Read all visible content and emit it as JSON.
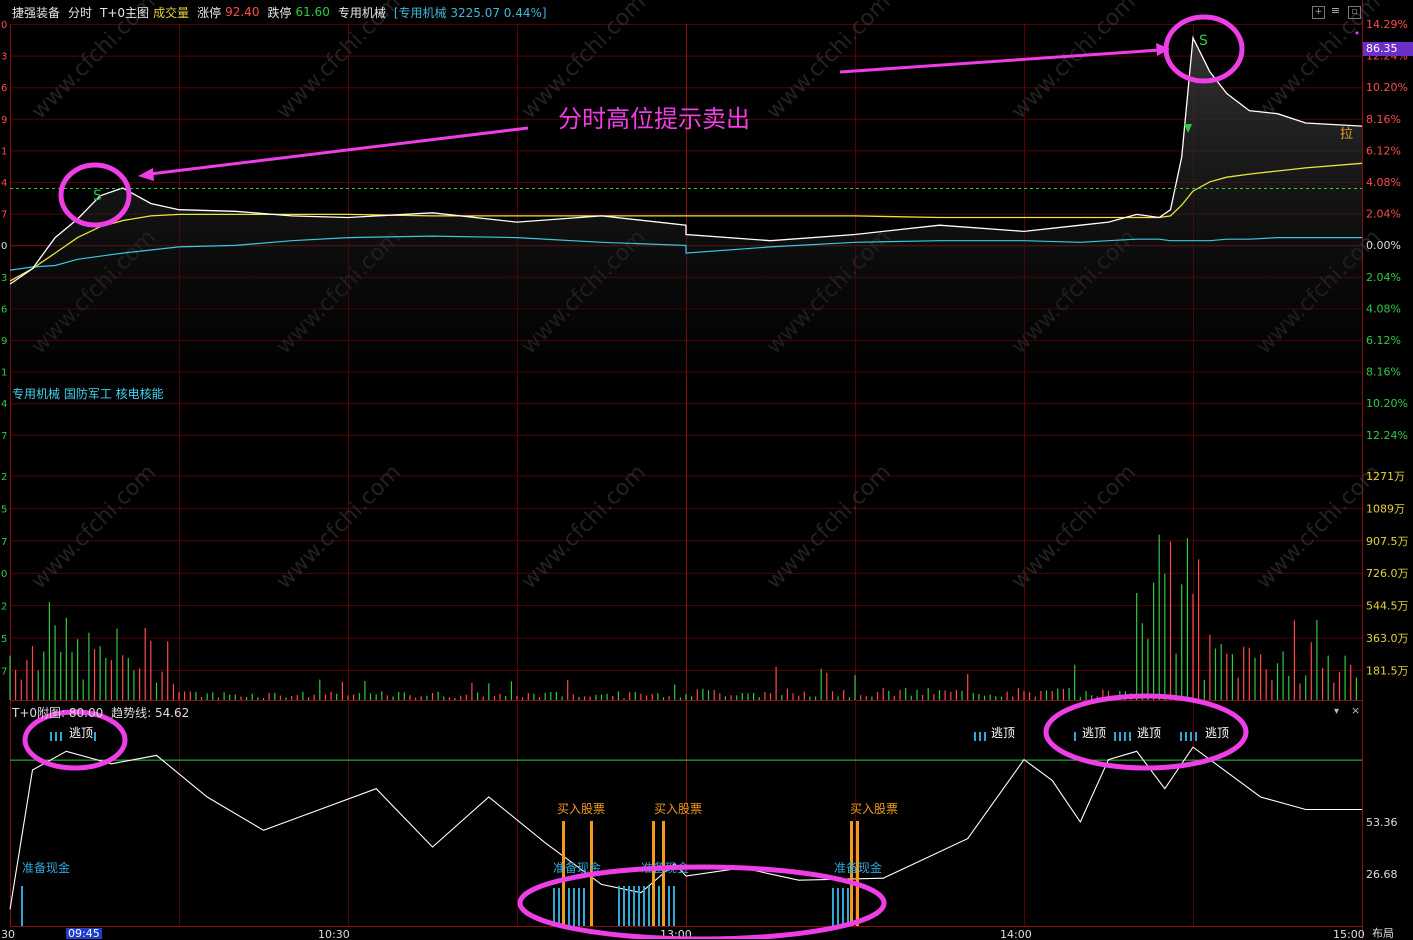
{
  "header": {
    "stock_name": "捷强装备",
    "tab_intraday": "分时",
    "tab_t0": "T+0主图",
    "volume_label": "成交量",
    "limit_up_label": "涨停",
    "limit_up_value": "92.40",
    "limit_down_label": "跌停",
    "limit_down_value": "61.60",
    "sector_name": "专用机械",
    "sector_index": "[专用机械 3225.07 0.44%]"
  },
  "sector_tags": "专用机械 国防军工 核电核能",
  "current_price_tag": "86.35",
  "right_axis_pct": [
    "14.29%",
    "12.24%",
    "10.20%",
    "8.16%",
    "6.12%",
    "4.08%",
    "2.04%",
    "0.00%",
    "2.04%",
    "4.08%",
    "6.12%",
    "8.16%",
    "10.20%",
    "12.24%"
  ],
  "left_axis_digits": [
    "0",
    "3",
    "6",
    "9",
    "1",
    "4",
    "7",
    "0",
    "3",
    "6",
    "9",
    "1",
    "4",
    "7",
    "2",
    "5",
    "7",
    "0",
    "2",
    "5",
    "7"
  ],
  "volume_axis": [
    "1271万",
    "1089万",
    "907.5万",
    "726.0万",
    "544.5万",
    "363.0万",
    "181.5万"
  ],
  "sub_axis": [
    "53.36",
    "26.68"
  ],
  "sub_title": {
    "name": "T+0附图",
    "value": ": 80.00",
    "trend_label": "趋势线:",
    "trend_value": "54.62"
  },
  "annotation_text": "分时高位提示卖出",
  "signals": {
    "sell": "S",
    "pull": "拉",
    "escape_top": "逃顶",
    "buy_stock": "买入股票",
    "prepare_cash": "准备现金"
  },
  "time_axis": [
    "30",
    "09:45",
    "10:30",
    "13:00",
    "14:00",
    "15:00"
  ],
  "layout_button": "布局",
  "watermark": "www.cfchi.com",
  "colors": {
    "price_line": "#ffffff",
    "avg_line": "#e6e63a",
    "index_line": "#39c8e0",
    "grid": "#5a0000",
    "up": "#ff4a4a",
    "down": "#2ecc40",
    "annotation": "#ee3ee6"
  },
  "chart_data": [
    {
      "type": "line",
      "name": "intraday-price",
      "ylabel": "change %",
      "ylim": [
        -14.29,
        14.29
      ],
      "x": [
        "09:30",
        "09:34",
        "09:38",
        "09:42",
        "09:46",
        "09:50",
        "09:55",
        "10:00",
        "10:10",
        "10:20",
        "10:30",
        "10:45",
        "11:00",
        "11:15",
        "11:30",
        "13:00",
        "13:15",
        "13:30",
        "13:45",
        "14:00",
        "14:10",
        "14:15",
        "14:20",
        "14:24",
        "14:26",
        "14:28",
        "14:30",
        "14:33",
        "14:36",
        "14:40",
        "14:45",
        "14:50",
        "15:00"
      ],
      "series": [
        {
          "values": [
            -2.2,
            -1.2,
            0.8,
            2.0,
            3.5,
            4.0,
            3.0,
            2.6,
            2.5,
            2.2,
            2.1,
            2.4,
            1.8,
            2.2,
            1.6,
            1.0,
            0.6,
            1.0,
            1.6,
            1.2,
            1.6,
            1.8,
            2.3,
            2.1,
            2.6,
            6.0,
            13.7,
            11.5,
            10.1,
            9.0,
            8.8,
            8.2,
            8.0
          ]
        },
        {
          "values": [
            -2.0,
            -1.2,
            -0.2,
            0.8,
            1.5,
            1.9,
            2.2,
            2.3,
            2.3,
            2.3,
            2.3,
            2.2,
            2.2,
            2.2,
            2.2,
            2.2,
            2.2,
            2.2,
            2.1,
            2.1,
            2.1,
            2.1,
            2.1,
            2.1,
            2.2,
            2.9,
            3.8,
            4.4,
            4.7,
            4.9,
            5.1,
            5.3,
            5.6
          ]
        },
        {
          "values": [
            -1.3,
            -1.1,
            -1.0,
            -0.6,
            -0.4,
            -0.2,
            0.0,
            0.2,
            0.3,
            0.6,
            0.8,
            0.9,
            0.8,
            0.5,
            0.3,
            -0.2,
            0.2,
            0.5,
            0.6,
            0.6,
            0.5,
            0.6,
            0.7,
            0.7,
            0.6,
            0.6,
            0.6,
            0.6,
            0.7,
            0.7,
            0.8,
            0.8,
            0.8
          ]
        }
      ]
    },
    {
      "type": "bar",
      "name": "volume",
      "ylabel": "volume (万)",
      "ylim": [
        0,
        1350
      ],
      "x_range": [
        "09:30",
        "15:00"
      ],
      "notes": "one bar per minute, red = up, green = down",
      "values_profile": [
        {
          "segment": "09:30-10:00",
          "typical": 380,
          "peak": 560
        },
        {
          "segment": "10:00-11:30",
          "typical": 70,
          "peak": 200
        },
        {
          "segment": "13:00-14:20",
          "typical": 60,
          "peak": 200
        },
        {
          "segment": "14:20-14:35",
          "typical": 700,
          "peak": 1240
        },
        {
          "segment": "14:35-15:00",
          "typical": 300,
          "peak": 490
        }
      ]
    },
    {
      "type": "line",
      "name": "T+0 indicator",
      "ylim": [
        0,
        100
      ],
      "reference_line": 80.0,
      "x": [
        "09:30",
        "09:34",
        "09:40",
        "09:48",
        "09:56",
        "10:05",
        "10:15",
        "10:25",
        "10:35",
        "10:45",
        "10:55",
        "11:05",
        "11:15",
        "11:22",
        "11:28",
        "13:00",
        "13:10",
        "13:20",
        "13:35",
        "13:50",
        "14:00",
        "14:05",
        "14:10",
        "14:15",
        "14:20",
        "14:25",
        "14:30",
        "14:35",
        "14:42",
        "14:50",
        "15:00"
      ],
      "values": [
        8,
        75,
        84,
        78,
        82,
        62,
        46,
        56,
        66,
        38,
        62,
        40,
        20,
        16,
        30,
        24,
        28,
        22,
        23,
        42,
        80,
        70,
        50,
        80,
        84,
        66,
        86,
        76,
        62,
        56,
        56
      ]
    }
  ]
}
